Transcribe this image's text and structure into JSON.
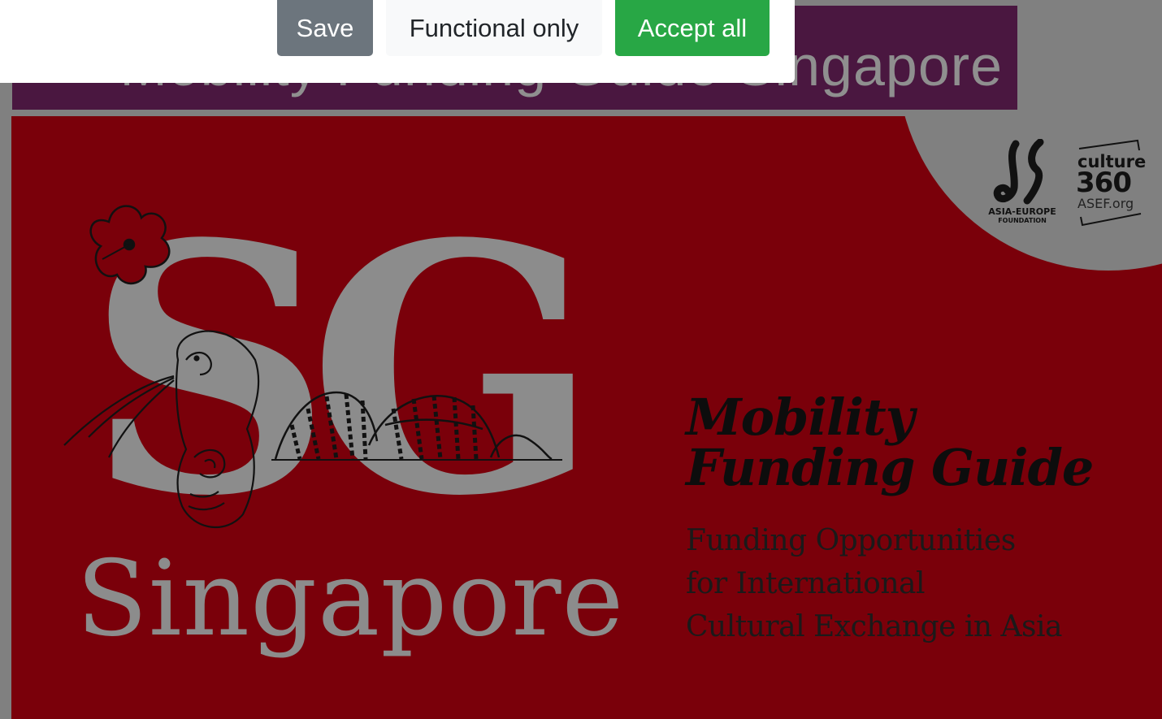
{
  "page": {
    "title_partial": "Mobility Funding Guide Singapore"
  },
  "consent": {
    "save_label": "Save",
    "functional_label": "Functional only",
    "accept_label": "Accept all"
  },
  "poster": {
    "monogram": "SG",
    "city": "Singapore",
    "title_line1": "Mobility",
    "title_line2": "Funding Guide",
    "subtitle_line1": "Funding Opportunities",
    "subtitle_line2": "for International",
    "subtitle_line3": "Cultural Exchange in Asia",
    "logo_asef_line1": "ASIA-EUROPE",
    "logo_asef_line2": "FOUNDATION",
    "logo_culture_word": "culture",
    "logo_culture_num": "360",
    "logo_culture_url": "ASEF.org"
  },
  "colors": {
    "poster_red": "#7a000a",
    "banner_purple": "#4a1740",
    "overlay_gray": "#808080",
    "save_gray": "#6c757d",
    "accept_green": "#28a745"
  }
}
